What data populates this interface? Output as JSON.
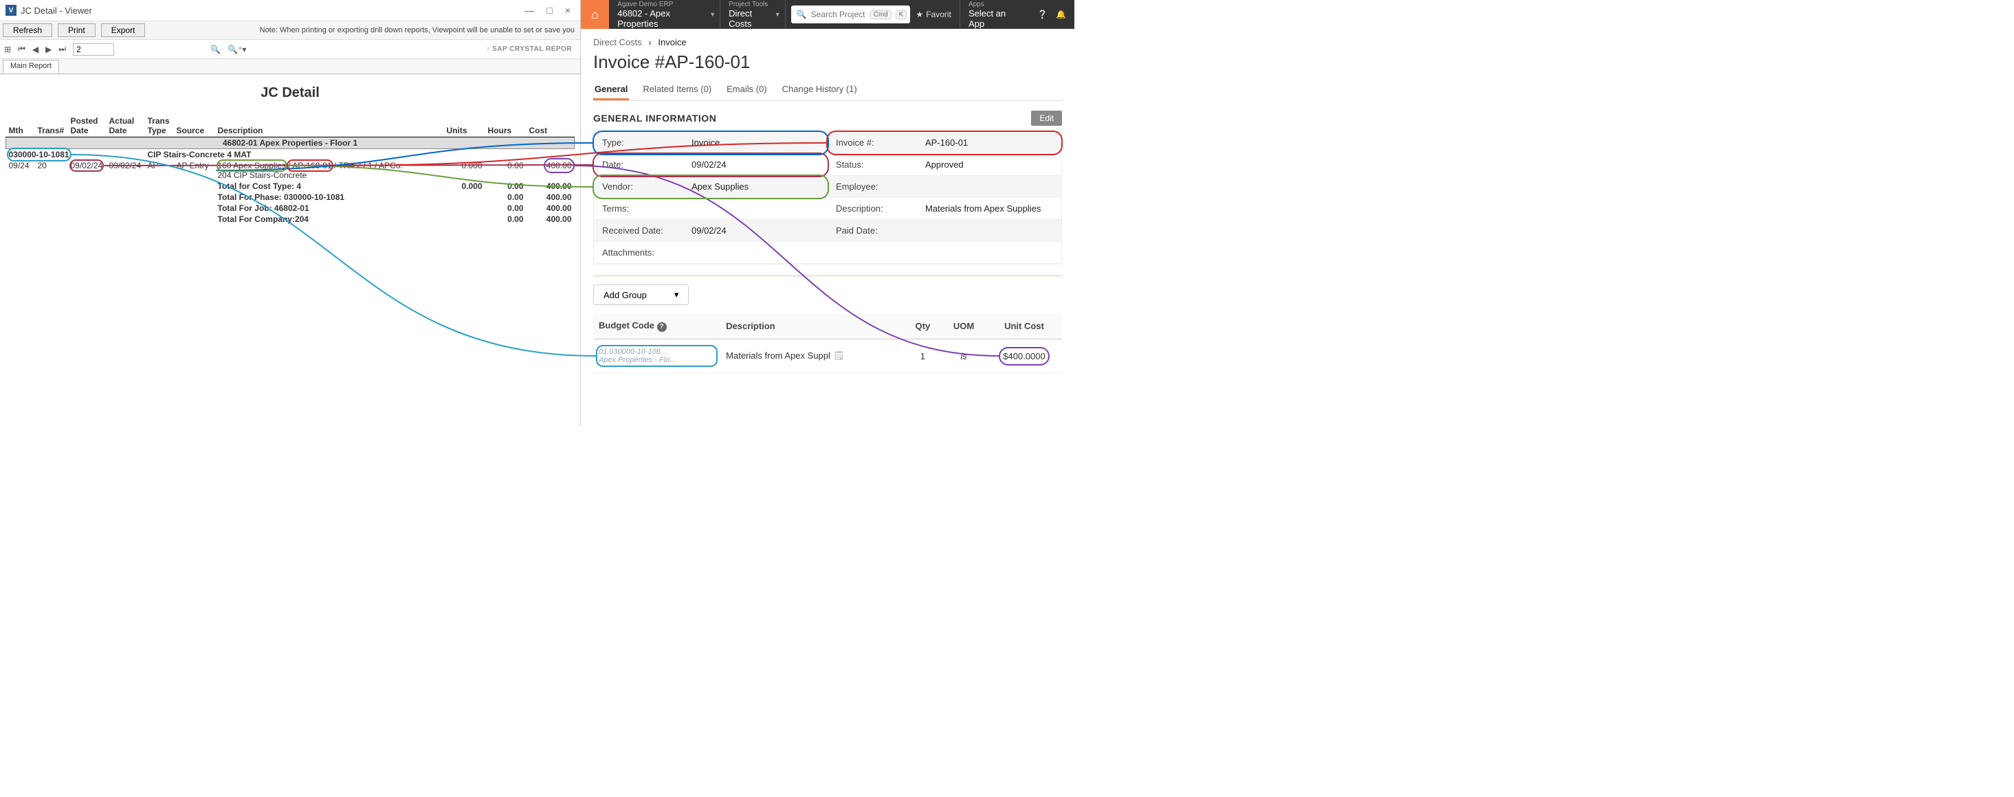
{
  "left": {
    "title": "JC Detail - Viewer",
    "toolbar": {
      "refresh": "Refresh",
      "print": "Print",
      "export": "Export"
    },
    "note": "Note: When printing or exporting drill down reports, Viewpoint will be unable to set or save you",
    "page": "2",
    "crystal": "SAP CRYSTAL REPOR",
    "tab": "Main Report",
    "report": {
      "title": "JC Detail",
      "headers": {
        "mth": "Mth",
        "trans": "Trans#",
        "posted": "Posted Date",
        "actual": "Actual Date",
        "ttype": "Trans Type",
        "source": "Source",
        "desc": "Description",
        "units": "Units",
        "hours": "Hours",
        "cost": "Cost"
      },
      "group": "46802-01  Apex Properties - Floor 1",
      "phase": "030000-10-1081",
      "phase_desc": "CIP Stairs-Concrete   4    MAT",
      "row": {
        "mth": "09/24",
        "trans": "20",
        "posted": "09/02/24",
        "actual": "09/02/24",
        "ttype": "AP",
        "source": "AP Entry",
        "vendor": "160 Apex Supplies",
        "inv": "AP-160-01",
        "trail": "/ TR# 2 / 1 / APCo:",
        "line2": "204  CIP Stairs-Concrete",
        "units": "0.000",
        "hours": "0.00",
        "cost": "400.00"
      },
      "totals": [
        {
          "label": "Total for Cost Type:   4",
          "units": "0.000",
          "hours": "0.00",
          "cost": "400.00"
        },
        {
          "label": "Total For Phase: 030000-10-1081",
          "units": "",
          "hours": "0.00",
          "cost": "400.00"
        },
        {
          "label": "Total For Job: 46802-01",
          "units": "",
          "hours": "0.00",
          "cost": "400.00"
        },
        {
          "label": "Total For Company:204",
          "units": "",
          "hours": "0.00",
          "cost": "400.00"
        }
      ]
    }
  },
  "right": {
    "topbar": {
      "seg1_small": "Agave Demo ERP",
      "seg1_big": "46802 - Apex Properties",
      "seg2_small": "Project Tools",
      "seg2_big": "Direct Costs",
      "search_ph": "Search Project",
      "cmd": "Cmd",
      "k": "K",
      "fav": "Favorit",
      "apps_small": "Apps",
      "apps_big": "Select an App"
    },
    "breadcrumb": {
      "a": "Direct Costs",
      "b": "Invoice"
    },
    "h1": "Invoice #AP-160-01",
    "tabs": {
      "general": "General",
      "related": "Related Items (0)",
      "emails": "Emails (0)",
      "history": "Change History (1)"
    },
    "section": "GENERAL INFORMATION",
    "edit": "Edit",
    "info": {
      "type_k": "Type:",
      "type_v": "Invoice",
      "invno_k": "Invoice #:",
      "invno_v": "AP-160-01",
      "date_k": "Date:",
      "date_v": "09/02/24",
      "status_k": "Status:",
      "status_v": "Approved",
      "vendor_k": "Vendor:",
      "vendor_v": "Apex Supplies",
      "emp_k": "Employee:",
      "emp_v": "",
      "terms_k": "Terms:",
      "terms_v": "",
      "desc_k": "Description:",
      "desc_v": "Materials from Apex Supplies",
      "recv_k": "Received Date:",
      "recv_v": "09/02/24",
      "paid_k": "Paid Date:",
      "paid_v": "",
      "att_k": "Attachments:",
      "att_v": ""
    },
    "add_group": "Add Group",
    "grid": {
      "h_budget": "Budget Code",
      "h_desc": "Description",
      "h_qty": "Qty",
      "h_uom": "UOM",
      "h_unit": "Unit Cost",
      "r_budget1": "01.030000-10-108…",
      "r_budget2": "Apex Properties - Flo…",
      "r_desc": "Materials from Apex Suppl",
      "r_qty": "1",
      "r_uom": "ls",
      "r_unit": "$400.0000"
    }
  }
}
